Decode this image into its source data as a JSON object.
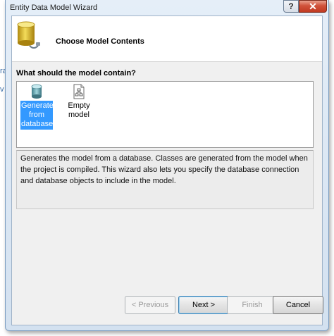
{
  "background_page": {
    "edge_text_1": "ra",
    "edge_text_2": "v"
  },
  "window": {
    "title": "Entity Data Model Wizard",
    "help_glyph": "?",
    "close_glyph": "✕"
  },
  "header": {
    "title": "Choose Model Contents",
    "icon": "database-wizard-icon"
  },
  "question": "What should the model contain?",
  "options": [
    {
      "label_lines": [
        "Generate",
        "from",
        "database"
      ],
      "icon": "database-icon",
      "selected": true
    },
    {
      "label_lines": [
        "Empty",
        "model"
      ],
      "icon": "empty-model-icon",
      "selected": false
    }
  ],
  "description": "Generates the model from a database. Classes are generated from the model when the project is compiled. This wizard also lets you specify the database connection and database objects to include in the model.",
  "buttons": {
    "previous": "< Previous",
    "next": "Next >",
    "finish": "Finish",
    "cancel": "Cancel"
  },
  "colors": {
    "selection": "#3399ff",
    "accent": "#3c7fb1",
    "close": "#c13a22"
  }
}
